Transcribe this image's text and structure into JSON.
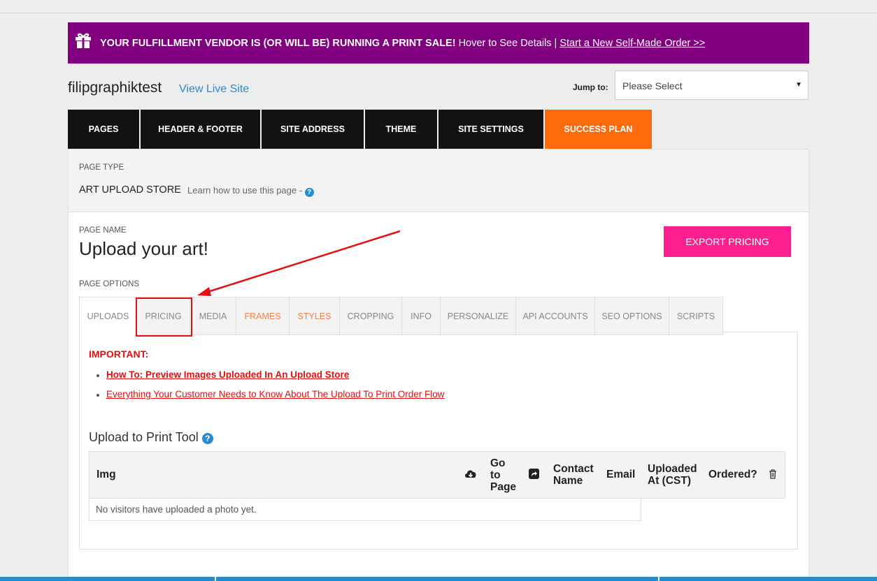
{
  "promo": {
    "bold_text": "YOUR FULFILLMENT VENDOR IS (OR WILL BE) RUNNING A PRINT SALE!",
    "hover_text": "Hover to See Details",
    "separator": "|",
    "link_text": "Start a New Self-Made Order >>",
    "icon": "gift-icon"
  },
  "header": {
    "site_name": "filipgraphiktest",
    "view_live": "View Live Site",
    "jump_label": "Jump to:",
    "jump_value": "Please Select"
  },
  "main_tabs": [
    {
      "label": "PAGES"
    },
    {
      "label": "HEADER & FOOTER"
    },
    {
      "label": "SITE ADDRESS"
    },
    {
      "label": "THEME"
    },
    {
      "label": "SITE SETTINGS"
    },
    {
      "label": "SUCCESS PLAN",
      "color": "#ff6b0b"
    }
  ],
  "page_type": {
    "label": "PAGE TYPE",
    "value": "ART UPLOAD STORE",
    "learn": "Learn how to use this page -",
    "help": "?"
  },
  "page_name": {
    "label": "PAGE NAME",
    "value": "Upload your art!"
  },
  "export_button": "EXPORT PRICING",
  "page_options_label": "PAGE OPTIONS",
  "sub_tabs": [
    {
      "label": "UPLOADS",
      "active": true
    },
    {
      "label": "PRICING"
    },
    {
      "label": "MEDIA"
    },
    {
      "label": "FRAMES",
      "highlight": true
    },
    {
      "label": "STYLES",
      "highlight": true
    },
    {
      "label": "CROPPING"
    },
    {
      "label": "INFO"
    },
    {
      "label": "PERSONALIZE"
    },
    {
      "label": "API ACCOUNTS"
    },
    {
      "label": "SEO OPTIONS"
    },
    {
      "label": "SCRIPTS"
    }
  ],
  "uploads": {
    "important": "IMPORTANT:",
    "links": [
      "How To: Preview Images Uploaded In An Upload Store",
      "Everything Your Customer Needs to Know About The Upload To Print Order Flow"
    ],
    "tool_title": "Upload to Print Tool",
    "columns": {
      "img": "Img",
      "go_to_page": "Go to Page",
      "contact_name": "Contact Name",
      "email": "Email",
      "uploaded_at": "Uploaded At (CST)",
      "ordered": "Ordered?"
    },
    "empty_message": "No visitors have uploaded a photo yet."
  },
  "colors": {
    "promo_bg": "#800080",
    "accent_orange": "#ff6b0b",
    "export_pink": "#ff1f8e",
    "link_red": "#e01010",
    "link_blue": "#2a8ad0"
  }
}
